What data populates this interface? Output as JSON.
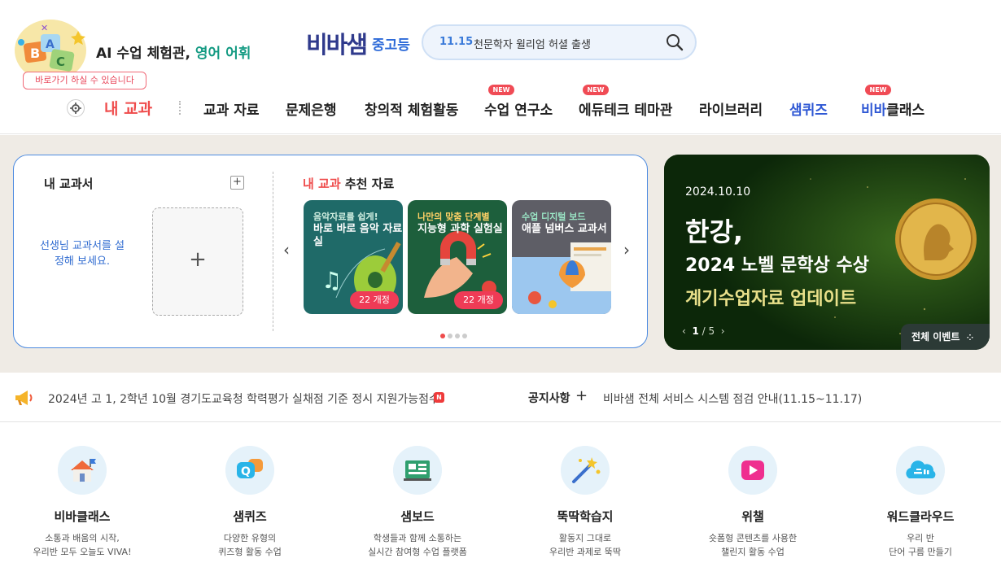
{
  "header": {
    "promo_text": "AI 수업 체험관, ",
    "promo_accent": "영어 어휘",
    "promo_tip": "바로가기 하실 수 있습니다",
    "logo": "비바샘",
    "logo_sub": "중고등",
    "search": {
      "date": "11.15",
      "text": "천문학자 윌리엄 허셜 출생"
    },
    "my_subject": "내 교과",
    "nav": [
      "교과 자료",
      "문제은행",
      "창의적 체험활동",
      "수업 연구소",
      "에듀테크 테마관",
      "라이브러리",
      "샘퀴즈",
      "비바",
      "클래스"
    ],
    "new_label": "NEW"
  },
  "mybook": {
    "title": "내 교과서",
    "hint": "선생님 교과서를 설정해 보세요.",
    "plus": "+",
    "rec_prefix": "내 교과",
    "rec_suffix": " 추천 자료",
    "cards": [
      {
        "tag": "음악자료를 쉽게!",
        "title": "바로 바로 음악 자료실",
        "badge": "22 개정"
      },
      {
        "tag": "나만의 맞춤 단계별",
        "title": "지능형 과학 실험실",
        "badge": "22 개정"
      },
      {
        "tag": "수업 디지털 보드",
        "title": "애플 넘버스 교과서",
        "badge": ""
      }
    ]
  },
  "event": {
    "date": "2024.10.10",
    "title": "한강,",
    "subtitle": "2024 노벨 문학상 수상",
    "subtitle2": "계기수업자료 업데이트",
    "pager_current": "1",
    "pager_total": " / 5",
    "all_label": "전체 이벤트"
  },
  "notice": {
    "text": "2024년 고 1, 2학년 10월 경기도교육청 학력평가 실채점 기준 정시 지원가능점수",
    "n_badge": "N",
    "label": "공지사항",
    "item": "비바샘 전체 서비스 시스템 점검 안내(11.15~11.17)"
  },
  "services": [
    {
      "name": "비바클래스",
      "desc1": "소통과 배움의 시작,",
      "desc2": "우리반 모두 오늘도 VIVA!"
    },
    {
      "name": "샘퀴즈",
      "desc1": "다양한 유형의",
      "desc2": "퀴즈형 활동 수업"
    },
    {
      "name": "샘보드",
      "desc1": "학생들과 함께 소통하는",
      "desc2": "실시간 참여형 수업 플랫폼"
    },
    {
      "name": "뚝딱학습지",
      "desc1": "활동지 그대로",
      "desc2": "우리반 과제로 뚝딱"
    },
    {
      "name": "위챌",
      "desc1": "숏폼형 콘텐츠를 사용한",
      "desc2": "챌린지 활동 수업"
    },
    {
      "name": "워드클라우드",
      "desc1": "우리 반",
      "desc2": "단어 구름 만들기"
    }
  ],
  "colors": {
    "accent_red": "#ef4b4b",
    "brand_blue": "#2f58d4",
    "teal": "#139a82",
    "hero_bg": "#efebe5"
  }
}
